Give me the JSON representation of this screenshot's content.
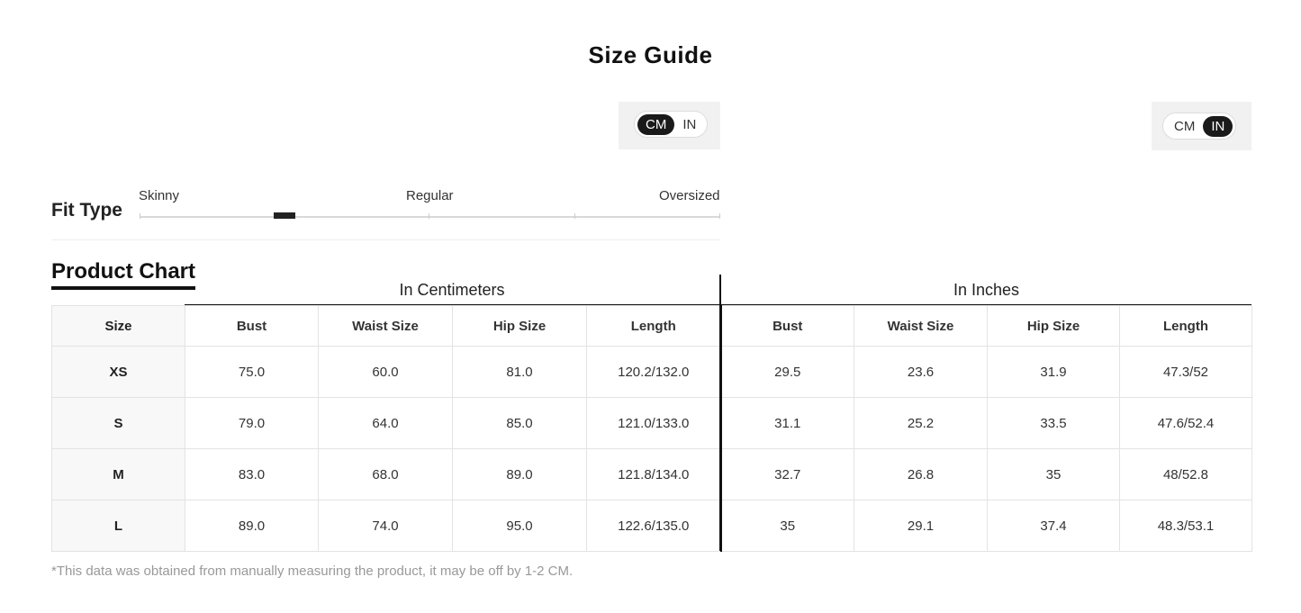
{
  "title": "Size Guide",
  "unit_toggles": [
    {
      "options": [
        "CM",
        "IN"
      ],
      "active": "CM"
    },
    {
      "options": [
        "CM",
        "IN"
      ],
      "active": "IN"
    }
  ],
  "fit": {
    "label": "Fit Type",
    "scale": [
      "Skinny",
      "Regular",
      "Oversized"
    ],
    "selected": "Skinny"
  },
  "chart": {
    "tab_label": "Product Chart",
    "group_cm": "In Centimeters",
    "group_in": "In Inches",
    "headers": [
      "Size",
      "Bust",
      "Waist Size",
      "Hip Size",
      "Length",
      "Bust",
      "Waist Size",
      "Hip Size",
      "Length"
    ],
    "rows": [
      [
        "XS",
        "75.0",
        "60.0",
        "81.0",
        "120.2/132.0",
        "29.5",
        "23.6",
        "31.9",
        "47.3/52"
      ],
      [
        "S",
        "79.0",
        "64.0",
        "85.0",
        "121.0/133.0",
        "31.1",
        "25.2",
        "33.5",
        "47.6/52.4"
      ],
      [
        "M",
        "83.0",
        "68.0",
        "89.0",
        "121.8/134.0",
        "32.7",
        "26.8",
        "35",
        "48/52.8"
      ],
      [
        "L",
        "89.0",
        "74.0",
        "95.0",
        "122.6/135.0",
        "35",
        "29.1",
        "37.4",
        "48.3/53.1"
      ]
    ]
  },
  "note": "*This data was obtained from manually measuring the product, it may be off by 1-2 CM."
}
